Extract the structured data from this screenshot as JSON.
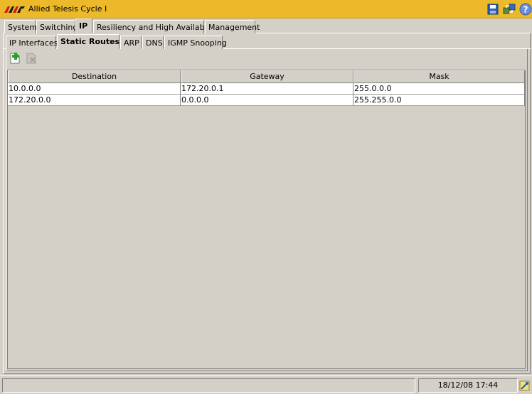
{
  "window": {
    "title": "Allied Telesis Cycle I",
    "brand_color": "#ecb92a",
    "icons": [
      "save-icon",
      "network-connect-icon",
      "help-icon"
    ]
  },
  "main_tabs": [
    {
      "label": "System",
      "active": false
    },
    {
      "label": "Switching",
      "active": false
    },
    {
      "label": "IP",
      "active": true
    },
    {
      "label": "Resiliency and High Availability",
      "active": false
    },
    {
      "label": "Management",
      "active": false
    }
  ],
  "sub_tabs": [
    {
      "label": "IP Interfaces",
      "active": false
    },
    {
      "label": "Static Routes",
      "active": true
    },
    {
      "label": "ARP",
      "active": false
    },
    {
      "label": "DNS",
      "active": false
    },
    {
      "label": "IGMP Snooping",
      "active": false
    }
  ],
  "toolbar": {
    "add_icon": "add-route-icon",
    "delete_icon": "delete-route-icon",
    "delete_enabled": false
  },
  "routes_table": {
    "columns": [
      "Destination",
      "Gateway",
      "Mask"
    ],
    "rows": [
      [
        "10.0.0.0",
        "172.20.0.1",
        "255.0.0.0"
      ],
      [
        "172.20.0.0",
        "0.0.0.0",
        "255.255.0.0"
      ]
    ]
  },
  "status": {
    "datetime": "18/12/08 17:44",
    "icon": "status-tool-icon"
  }
}
